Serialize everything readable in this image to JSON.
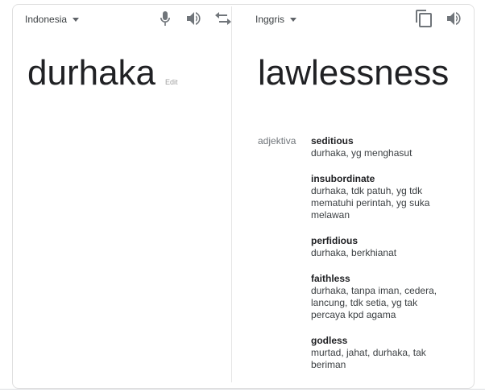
{
  "source": {
    "language": "Indonesia",
    "text": "durhaka",
    "edit_label": "Edit"
  },
  "target": {
    "language": "Inggris",
    "text": "lawlessness"
  },
  "icons": {
    "mic": "microphone-icon",
    "speaker": "speaker-icon",
    "swap": "swap-languages-icon",
    "copy": "copy-icon"
  },
  "dictionary": {
    "part_of_speech": "adjektiva",
    "entries": [
      {
        "word": "seditious",
        "meanings": "durhaka, yg menghasut"
      },
      {
        "word": "insubordinate",
        "meanings": "durhaka, tdk patuh, yg tdk mematuhi perintah, yg suka melawan"
      },
      {
        "word": "perfidious",
        "meanings": "durhaka, berkhianat"
      },
      {
        "word": "faithless",
        "meanings": "durhaka, tanpa iman, cedera, lancung, tdk setia, yg tak percaya kpd agama"
      },
      {
        "word": "godless",
        "meanings": "murtad, jahat, durhaka, tak beriman"
      }
    ]
  }
}
